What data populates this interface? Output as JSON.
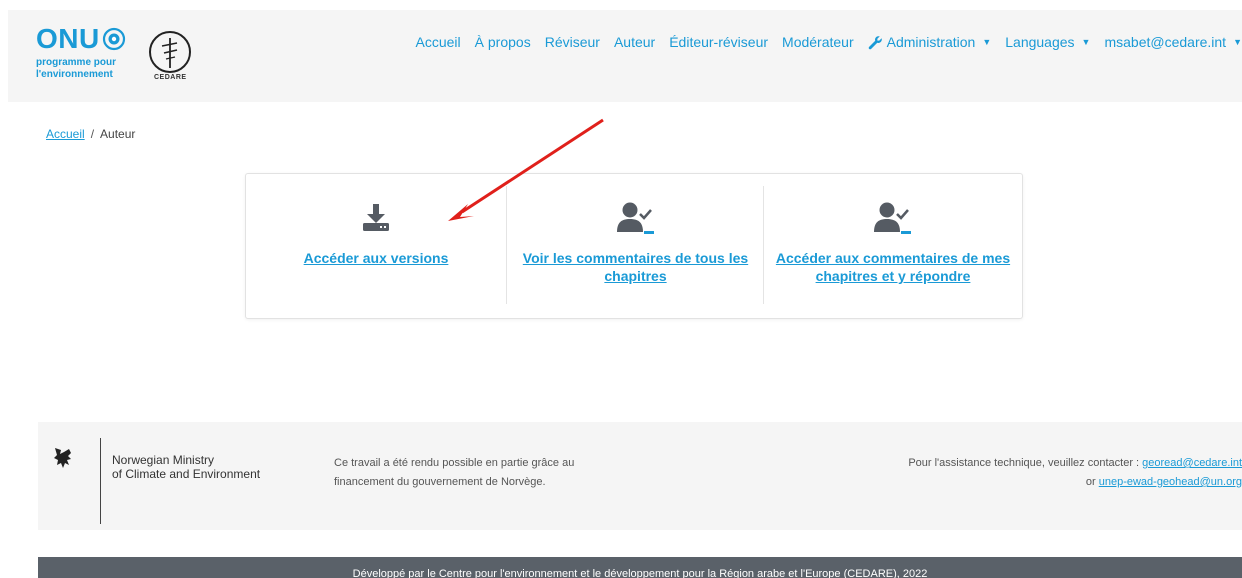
{
  "header": {
    "logo_onu": {
      "word": "ONU",
      "sub": "programme pour l'environnement"
    },
    "logo_cedare": {
      "text": "CEDARE"
    },
    "nav": {
      "accueil": "Accueil",
      "a_propos": "À propos",
      "reviseur": "Réviseur",
      "auteur": "Auteur",
      "editeur_reviseur": "Éditeur-réviseur",
      "moderateur": "Modérateur",
      "administration": "Administration",
      "languages": "Languages",
      "user": "msabet@cedare.int"
    }
  },
  "breadcrumb": {
    "home": "Accueil",
    "separator": "/",
    "current": "Auteur"
  },
  "cards": {
    "versions": {
      "label": "Accéder aux versions",
      "icon": "download-icon"
    },
    "all_comments": {
      "label": "Voir les commentaires de tous les chapitres",
      "icon": "user-check-icon"
    },
    "my_comments": {
      "label": "Accéder aux commentaires de mes chapitres et y répondre",
      "icon": "user-check-icon"
    }
  },
  "footer": {
    "ministry_line1": "Norwegian Ministry",
    "ministry_line2": "of Climate and Environment",
    "funding_line1": "Ce travail a été rendu possible en partie grâce au",
    "funding_line2": "financement du gouvernement de Norvège.",
    "contact_text": "Pour l'assistance technique, veuillez contacter : ",
    "contact_email": "georead@cedare.int",
    "contact_or": "or ",
    "contact_email2": "unep-ewad-geohead@un.org",
    "bottom": "Développé par le Centre pour l'environnement et le développement pour la Région arabe et l'Europe (CEDARE), 2022"
  },
  "colors": {
    "link": "#1a9ad6",
    "icon": "#555b63",
    "icon_accent": "#1a9ad6",
    "annotation_arrow": "#e0201b",
    "bottom_bar": "#5a6169"
  }
}
